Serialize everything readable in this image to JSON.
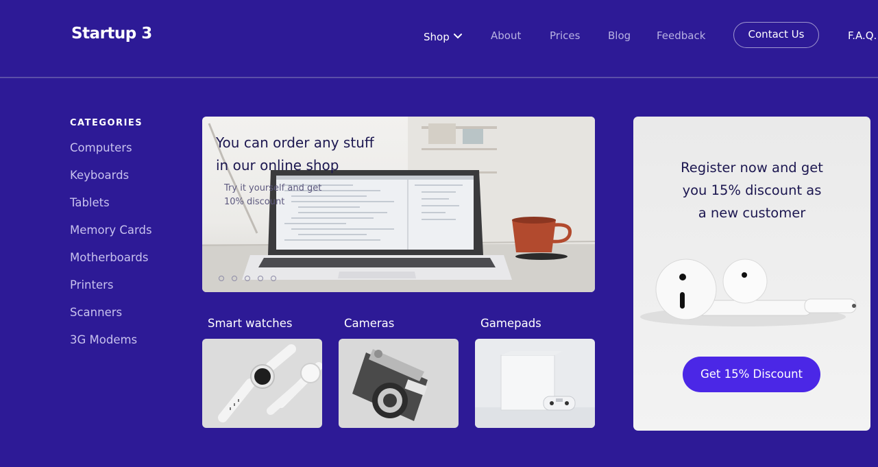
{
  "header": {
    "logo": "Startup 3",
    "nav": [
      {
        "label": "Shop"
      },
      {
        "label": "About"
      },
      {
        "label": "Prices"
      },
      {
        "label": "Blog"
      },
      {
        "label": "Feedback"
      }
    ],
    "contact_label": "Contact Us",
    "faq_label": "F.A.Q."
  },
  "sidebar": {
    "title": "CATEGORIES",
    "items": [
      "Computers",
      "Keyboards",
      "Tablets",
      "Memory Cards",
      "Motherboards",
      "Printers",
      "Scanners",
      "3G Modems"
    ]
  },
  "hero": {
    "title_line1": "You can order any stuff",
    "title_line2": "in our online shop",
    "sub_line1": "Try it yourself and get",
    "sub_line2": "10% discount",
    "slide_count": 5
  },
  "products": [
    {
      "label": "Smart watches",
      "icon": "watch-image"
    },
    {
      "label": "Cameras",
      "icon": "camera-image"
    },
    {
      "label": "Gamepads",
      "icon": "console-image"
    }
  ],
  "promo": {
    "line1": "Register now and get",
    "line2": "you 15% discount as",
    "line3": "a new customer",
    "button": "Get 15% Discount",
    "icon": "earbuds-image"
  },
  "colors": {
    "background": "#2d1a96",
    "accent_button": "#4b27e6",
    "dark_text": "#1c1750"
  }
}
